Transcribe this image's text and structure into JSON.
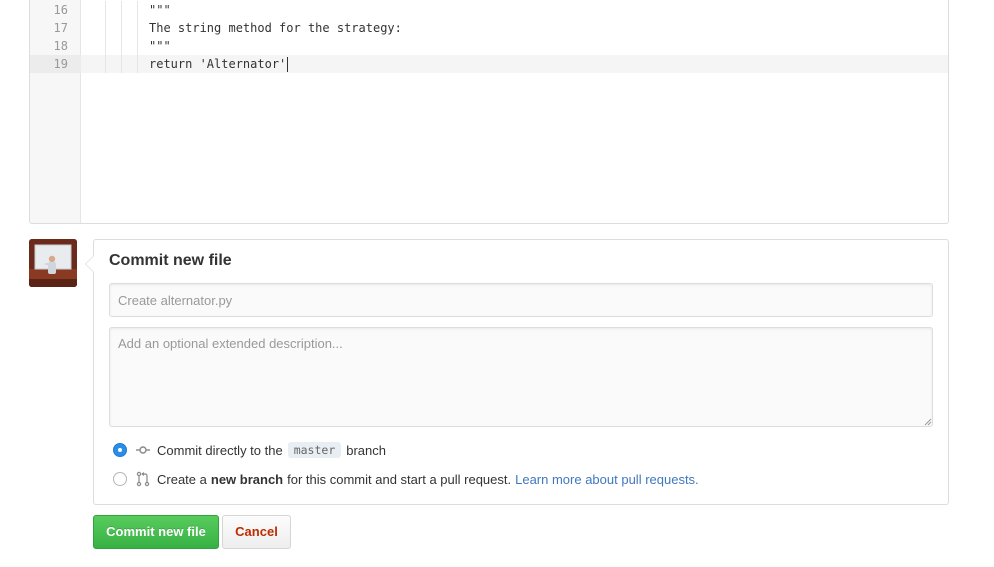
{
  "editor": {
    "lines": [
      {
        "number": "16",
        "text": "\"\"\""
      },
      {
        "number": "17",
        "text": "The string method for the strategy:"
      },
      {
        "number": "18",
        "text": "\"\"\""
      },
      {
        "number": "19",
        "text": "return 'Alternator'"
      }
    ],
    "active_line": "19"
  },
  "commit": {
    "title": "Commit new file",
    "summary_placeholder": "Create alternator.py",
    "description_placeholder": "Add an optional extended description...",
    "option_direct": {
      "prefix": "Commit directly to the",
      "branch": "master",
      "suffix": "branch",
      "checked": true
    },
    "option_new_branch": {
      "prefix": "Create a",
      "bold": "new branch",
      "suffix": "for this commit and start a pull request.",
      "link": "Learn more about pull requests.",
      "checked": false
    }
  },
  "buttons": {
    "commit": "Commit new file",
    "cancel": "Cancel"
  },
  "colors": {
    "accent_green": "#38b144",
    "link_blue": "#4078c0",
    "cancel_red": "#bd2c00",
    "radio_blue": "#2a8de8"
  },
  "icons": {
    "commit_option": "git-commit-icon",
    "branch_option": "git-pull-request-icon"
  }
}
